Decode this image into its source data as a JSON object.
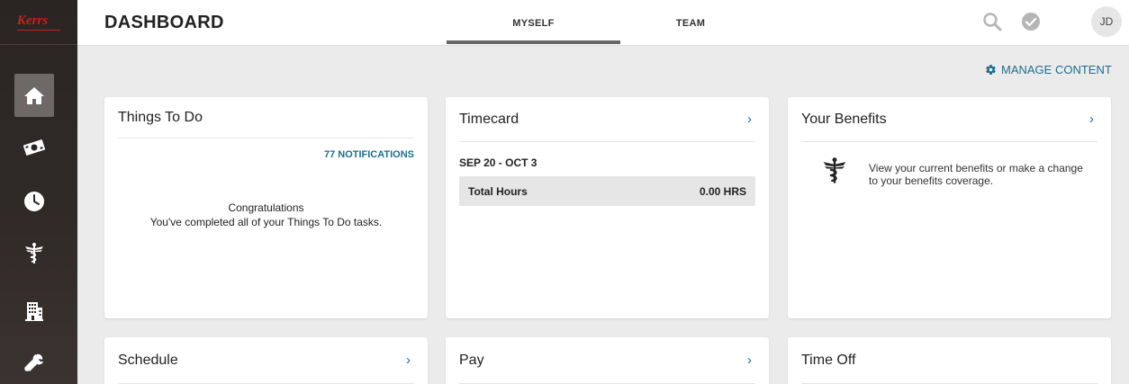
{
  "sidebar": {
    "logo": "Kerrs",
    "items": [
      {
        "name": "home",
        "active": true
      },
      {
        "name": "pay"
      },
      {
        "name": "time"
      },
      {
        "name": "benefits"
      },
      {
        "name": "company"
      },
      {
        "name": "tools"
      }
    ]
  },
  "header": {
    "title": "DASHBOARD",
    "tabs": [
      {
        "label": "MYSELF",
        "active": true
      },
      {
        "label": "TEAM",
        "active": false
      }
    ],
    "avatar_initials": "JD"
  },
  "manage_content_label": "MANAGE CONTENT",
  "cards": {
    "things_to_do": {
      "title": "Things To Do",
      "notifications": "77 NOTIFICATIONS",
      "congrats_title": "Congratulations",
      "congrats_body": "You've completed all of your Things To Do tasks."
    },
    "timecard": {
      "title": "Timecard",
      "chevron": "›",
      "date_range": "SEP 20 - OCT 3",
      "hours_label": "Total Hours",
      "hours_value": "0.00 HRS"
    },
    "benefits": {
      "title": "Your Benefits",
      "chevron": "›",
      "description": "View your current benefits or make a change to your benefits coverage."
    },
    "schedule": {
      "title": "Schedule",
      "chevron": "›"
    },
    "pay": {
      "title": "Pay",
      "chevron": "›"
    },
    "time_off": {
      "title": "Time Off"
    }
  },
  "colors": {
    "accent": "#1d6e8e",
    "sidebar_bg": "#2a2523",
    "page_bg": "#ebebeb"
  }
}
